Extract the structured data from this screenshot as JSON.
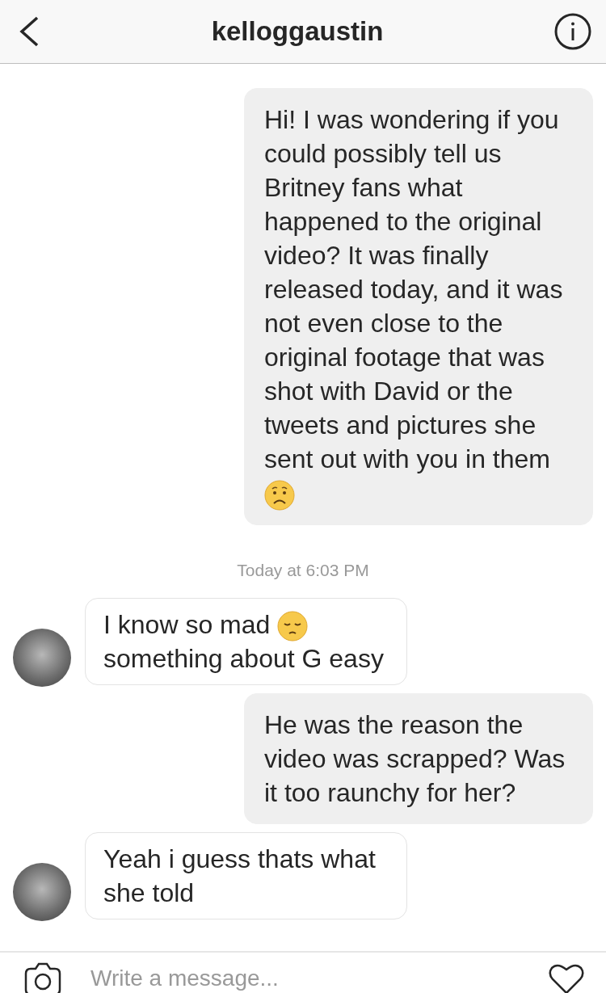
{
  "header": {
    "title": "kelloggaustin"
  },
  "messages": [
    {
      "kind": "sent",
      "text": "Hi! I was wondering if you could possibly tell us Britney fans what happened to the original video? It was finally released today, and it was not even close to the original footage that was shot with David or the tweets and pictures she sent out with you in them",
      "worried_face": true
    },
    {
      "kind": "timestamp",
      "text": "Today at 6:03 PM"
    },
    {
      "kind": "received",
      "text": "I know so mad",
      "pensive_face": true,
      "text_after": "something about G easy"
    },
    {
      "kind": "sent",
      "text": "He was the reason the video was scrapped? Was it too raunchy for her?"
    },
    {
      "kind": "received",
      "text": "Yeah i guess thats what she told"
    }
  ],
  "composer": {
    "placeholder": "Write a message..."
  }
}
